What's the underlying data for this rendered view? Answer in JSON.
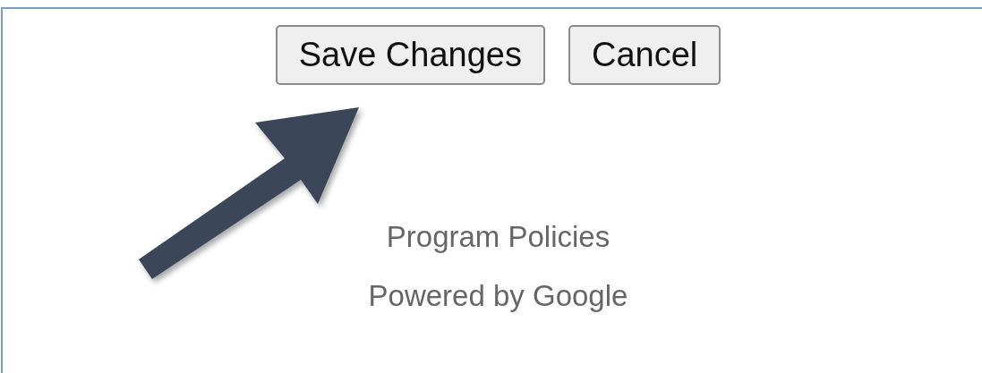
{
  "buttons": [
    {
      "label": "Save Changes"
    },
    {
      "label": "Cancel"
    }
  ],
  "footer_links": [
    "Program Policies",
    "Powered by Google"
  ]
}
